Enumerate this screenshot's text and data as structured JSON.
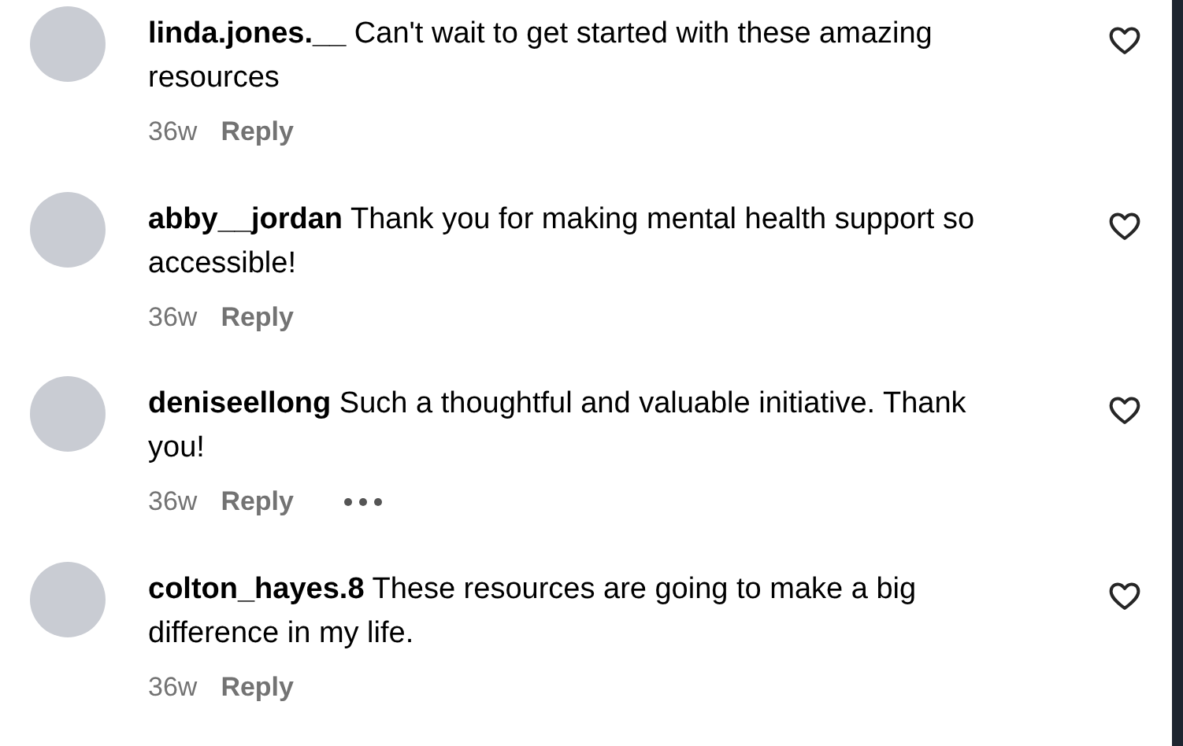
{
  "comments": [
    {
      "username": "linda.jones.__",
      "text": "Can't wait to get started with these amazing resources",
      "time": "36w",
      "reply": "Reply",
      "options_visible": false
    },
    {
      "username": "abby__jordan",
      "text": "Thank you for making mental health support so accessible!",
      "time": "36w",
      "reply": "Reply",
      "options_visible": false
    },
    {
      "username": "deniseellong",
      "text": "Such a thoughtful and valuable initiative. Thank you!",
      "time": "36w",
      "reply": "Reply",
      "options_visible": true
    },
    {
      "username": "colton_hayes.8",
      "text": "These resources are going to make a big difference in my life.",
      "time": "36w",
      "reply": "Reply",
      "options_visible": false
    }
  ]
}
